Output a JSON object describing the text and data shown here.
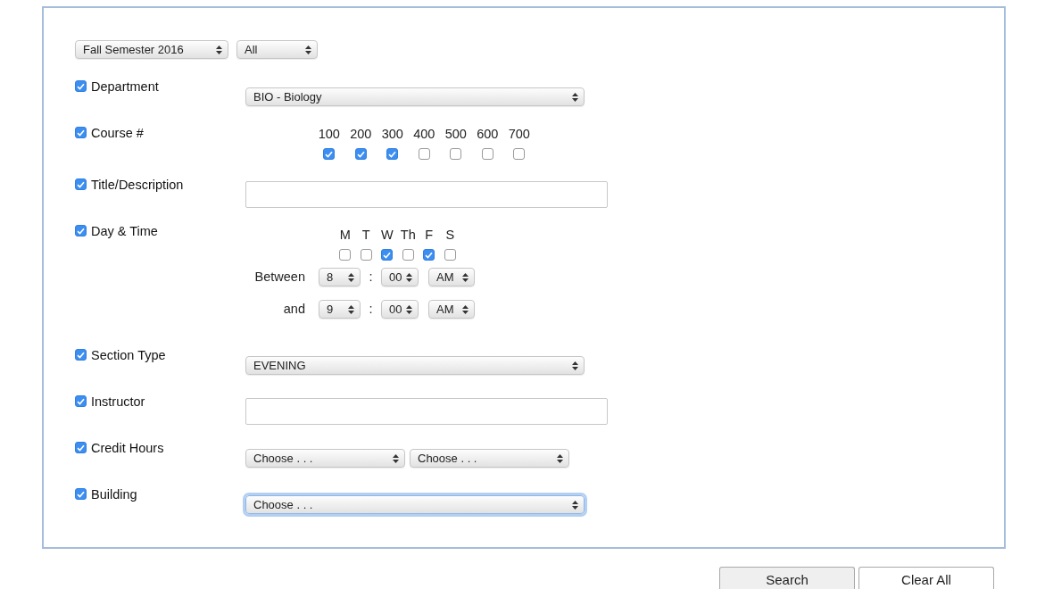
{
  "term_filters": [
    {
      "value": "Fall Semester 2016",
      "kind": "term"
    },
    {
      "value": "All",
      "kind": "session"
    }
  ],
  "criteria": [
    {
      "label": "Department",
      "checked": true,
      "kind": "select",
      "selects": [
        {
          "value": "BIO - Biology",
          "focused": false
        }
      ]
    },
    {
      "label": "Course #",
      "checked": true,
      "kind": "checks",
      "options": [
        {
          "label": "100",
          "checked": true
        },
        {
          "label": "200",
          "checked": true
        },
        {
          "label": "300",
          "checked": true
        },
        {
          "label": "400",
          "checked": false
        },
        {
          "label": "500",
          "checked": false
        },
        {
          "label": "600",
          "checked": false
        },
        {
          "label": "700",
          "checked": false
        }
      ]
    },
    {
      "label": "Title/Description",
      "checked": true,
      "kind": "text"
    },
    {
      "label": "Day & Time",
      "checked": true,
      "kind": "daytime",
      "options": [
        {
          "label": "M",
          "checked": false
        },
        {
          "label": "T",
          "checked": false
        },
        {
          "label": "W",
          "checked": true
        },
        {
          "label": "Th",
          "checked": false
        },
        {
          "label": "F",
          "checked": true
        },
        {
          "label": "S",
          "checked": false
        }
      ],
      "times": [
        {
          "label": "Between",
          "hour": "8",
          "separator": ":",
          "minute": "00",
          "period": "AM"
        },
        {
          "label": "and",
          "hour": "9",
          "separator": ":",
          "minute": "00",
          "period": "AM"
        }
      ]
    },
    {
      "label": "Section Type",
      "checked": true,
      "kind": "select",
      "selects": [
        {
          "value": "EVENING",
          "focused": false
        }
      ]
    },
    {
      "label": "Instructor",
      "checked": true,
      "kind": "text"
    },
    {
      "label": "Credit Hours",
      "checked": true,
      "kind": "select",
      "selects": [
        {
          "value": "Choose . . .",
          "focused": false
        },
        {
          "value": "Choose . . .",
          "focused": false
        }
      ]
    },
    {
      "label": "Building",
      "checked": true,
      "kind": "select",
      "selects": [
        {
          "value": "Choose . . .",
          "focused": true
        }
      ]
    }
  ],
  "buttons": [
    {
      "label": "Search",
      "kind": "primary"
    },
    {
      "label": "Clear All",
      "kind": "secondary"
    }
  ]
}
